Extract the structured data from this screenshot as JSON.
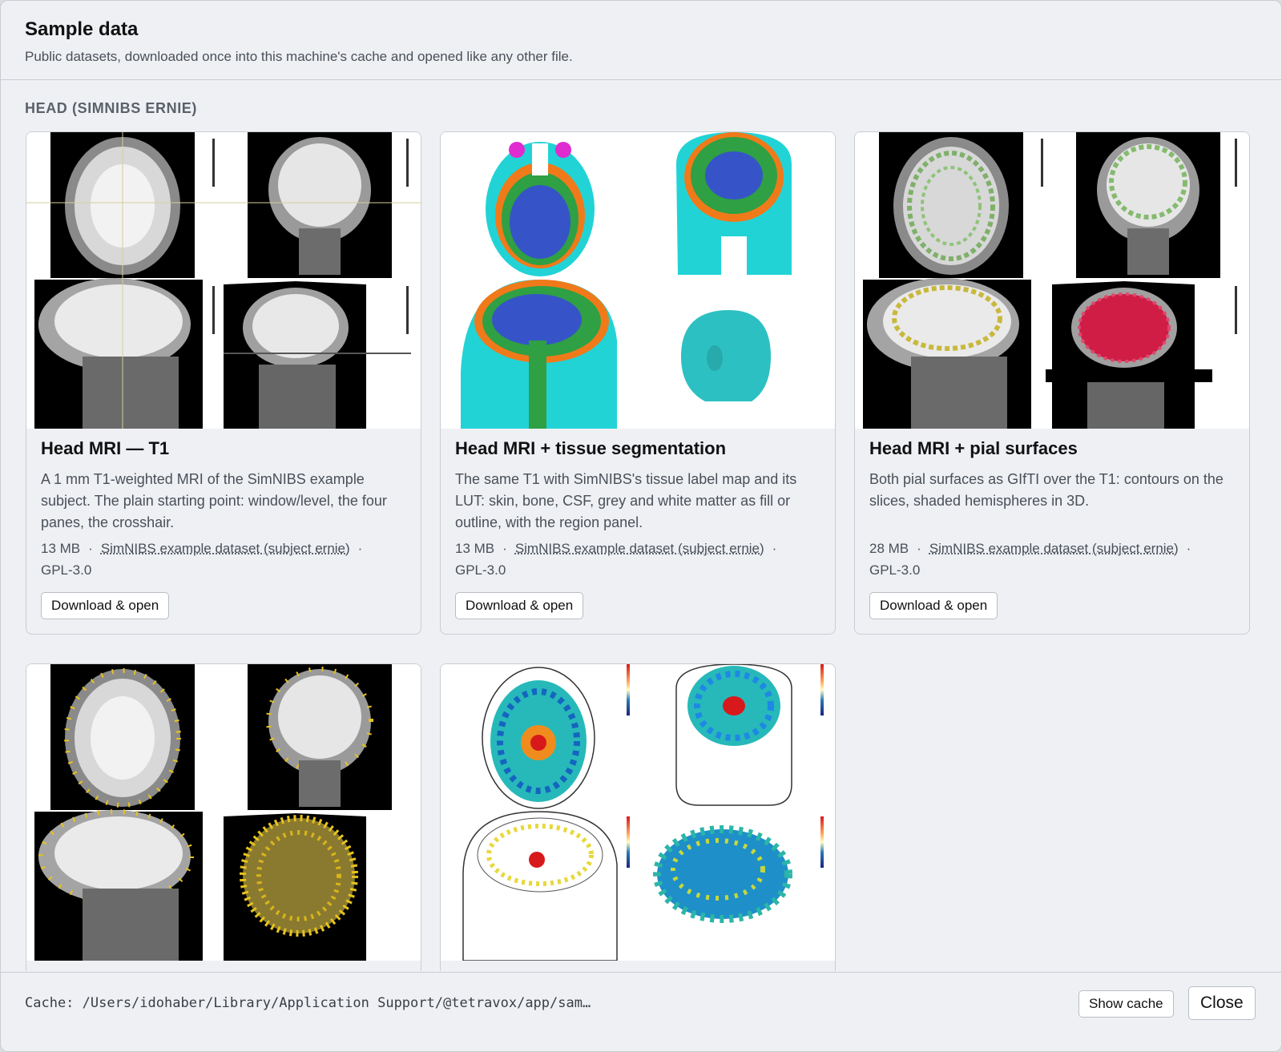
{
  "dialog": {
    "title": "Sample data",
    "subtitle": "Public datasets, downloaded once into this machine's cache and opened like any other file."
  },
  "section": {
    "title": "HEAD (SIMNIBS ERNIE)"
  },
  "cards": [
    {
      "title": "Head MRI — T1",
      "description": "A 1 mm T1-weighted MRI of the SimNIBS example subject. The plain starting point: window/level, the four panes, the crosshair.",
      "size": "13 MB",
      "source": "SimNIBS example dataset (subject ernie)",
      "license": "GPL-3.0",
      "button": "Download & open"
    },
    {
      "title": "Head MRI + tissue segmentation",
      "description": "The same T1 with SimNIBS's tissue label map and its LUT: skin, bone, CSF, grey and white matter as fill or outline, with the region panel.",
      "size": "13 MB",
      "source": "SimNIBS example dataset (subject ernie)",
      "license": "GPL-3.0",
      "button": "Download & open"
    },
    {
      "title": "Head MRI + pial surfaces",
      "description": "Both pial surfaces as GIfTI over the T1: contours on the slices, shaded hemispheres in 3D.",
      "size": "28 MB",
      "source": "SimNIBS example dataset (subject ernie)",
      "license": "GPL-3.0",
      "button": "Download & open"
    }
  ],
  "footer": {
    "cache_path": "Cache: /Users/idohaber/Library/Application Support/@tetravox/app/sam…",
    "show_cache": "Show cache",
    "close": "Close"
  }
}
